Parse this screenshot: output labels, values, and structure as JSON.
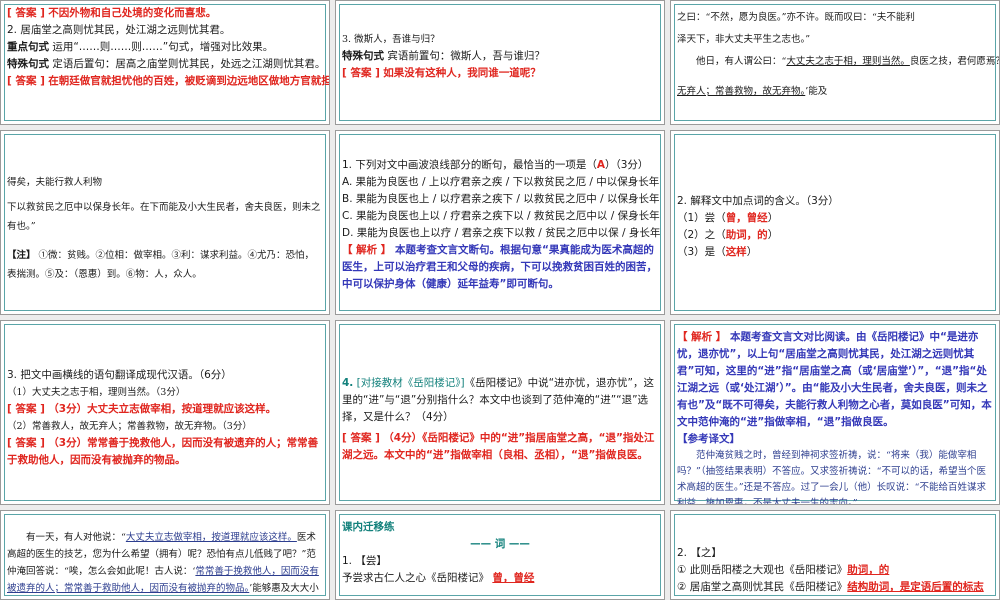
{
  "s1": {
    "l1_label": "[ 答案 ]",
    "l1_text": "不因外物和自己处境的变化而喜悲。",
    "l2": "2. 居庙堂之高则忧其民，处江湖之远则忧其君。",
    "l3_label": "重点句式",
    "l3_text": "运用“……则……则……”句式，增强对比效果。",
    "l4_label": "特殊句式",
    "l4_text": "定语后置句：居高之庙堂则忧其民，处远之江湖则忧其君。",
    "l5_label": "[ 答案 ]",
    "l5_text": "在朝廷做官就担忧他的百姓，被贬谪到边远地区做地方官就担忧他的君主。"
  },
  "s2": {
    "l1": "3. 微斯人，吾谁与归？",
    "l2_label": "特殊句式",
    "l2_text": "宾语前置句：微斯人，吾与谁归？",
    "l3_label": "[ 答案 ]",
    "l3_text": "如果没有这种人，我同谁一道呢？"
  },
  "s3": {
    "l1": "之曰：“不然，愿为良医。”亦不许。既而叹曰：“夫不能利",
    "l2": "泽天下，非大丈夫平生之志也。”",
    "l3_pre": "他日，有人谓公曰：“",
    "l3_ul": "大丈夫之志于相，理则当然。",
    "l3_post": "良医之技，君何愿焉？尤乃",
    "l4": "焉？尤乃",
    "l5_ul": "无弃人；常善救物，故无弃物。",
    "l5_post": "’能及"
  },
  "s4": {
    "l1": "得矣，夫能行救人利物",
    "l2": "下以救贫民之厄中以保身长年。在下而能及小大生民者，舍夫良医，则未之",
    "l3": "有也。”",
    "note_label": "【注】",
    "note_text": "①微：贫贱。②位相：做宰相。③利：谋求利益。④尤乃：恐怕，表揣测。⑤及：（恩惠）到。⑥物：人，众人。"
  },
  "s5": {
    "q_pre": "1. 下列对文中画波浪线部分的断句，最恰当的一项是（",
    "q_ans": "A",
    "q_post": "）（3分）",
    "a": "A. 果能为良医也 / 上以疗君亲之疾 / 下以救贫民之厄 / 中以保身长年",
    "b": "B. 果能为良医也上 / 以疗君亲之疾下 / 以救贫民之厄中 / 以保身长年",
    "c": "C. 果能为良医也上以 / 疗君亲之疾下以 / 救贫民之厄中以 / 保身长年",
    "d": "D. 果能为良医也上以疗 / 君亲之疾下以救 / 贫民之厄中以保 / 身长年",
    "exp_label": "【 解析 】",
    "exp_text": "本题考查文言文断句。根据句意“果真能成为医术高超的医生，上可以治疗君王和父母的疾病，下可以挽救贫困百姓的困苦，中可以保护身体（健康）延年益寿”即可断句。"
  },
  "s6": {
    "q": "2. 解释文中加点词的含义。（3分）",
    "i1_pre": "（1）尝",
    "i1_ans": "曾，曾经",
    "i1_post": "）",
    "i2_pre": "（2）之",
    "i2_ans": "助词，的",
    "i2_post": "）",
    "i3_pre": "（3）是",
    "i3_ans": "这样",
    "i3_post": "）"
  },
  "s7": {
    "q": "3. 把文中画横线的语句翻译成现代汉语。（6分）",
    "i1": "（1）大丈夫之志于相，理则当然。（3分）",
    "a1_label": "[ 答案 ]",
    "a1_text": "（3分）大丈夫立志做宰相，按道理就应该这样。",
    "i2": "（2）常善救人，故无弃人；常善救物，故无弃物。（3分）",
    "a2_label": "[ 答案 ]",
    "a2_text": "（3分）常常善于挽救他人，因而没有被遗弃的人；常常善于救助他人，因而没有被抛弃的物品。"
  },
  "s8": {
    "q_num": "4.",
    "q_tag": "[对接教材《岳阳楼记》]",
    "q_text": "《岳阳楼记》中说“进亦忧，退亦忧”，这里的“进”与“退”分别指什么？本文中也谈到了范仲淹的“进”“退”选择，又是什么？（4分）",
    "a_label": "[ 答案 ]",
    "a_text": "（4分）《岳阳楼记》中的“进”指居庙堂之高，“退”指处江湖之远。本文中的“进”指做宰相（良相、丞相），“退”指做良医。"
  },
  "s9": {
    "exp_label": "【 解析 】",
    "exp_text": "本题考查文言文对比阅读。由《岳阳楼记》中“是进亦忧，退亦忧”，以上句“居庙堂之高则忧其民，处江湖之远则忧其君”可知，这里的“进”指“居庙堂之高（或‘居庙堂’）”，“退”指“处江湖之远（或‘处江湖’）”。由“能及小大生民者，舍夫良医，则未之有也”及“既不可得矣，夫能行救人利物之心者，莫如良医”可知，本文中范仲淹的“进”指做宰相，“退”指做良医。",
    "ref_label": "【参考译文】",
    "ref_text": "范仲淹贫贱之时，曾经到神祠求签祈祷，说：“将来（我）能做宰相吗？”（抽签结果表明）不答应。又求签祈祷说：“不可以的话，希望当个医术高超的医生。”还是不答应。过了一会儿（他）长叹说：“不能给百姓谋求利益、施加恩惠，不是大丈夫一生的志向。”"
  },
  "s10": {
    "l1_pre": "有一天，有人对他说：“",
    "l1_ul": "大丈夫立志做宰相，按道理就应该这样。",
    "l1_post": "医术高超的医生的技艺，您为什么希望（拥有）呢？恐怕有点儿低贱了吧？”范仲淹回答说：“唉，怎么会如此呢！古人说：‘",
    "l2_ul": "常常善于挽救他人，因而没有被遗弃的人；常常善于救助他人，因而没有被抛弃的物品。",
    "l2_post": "’能够惠及大大小小的百姓"
  },
  "s11": {
    "title": "课内迁移练",
    "sub": "—— 词 ——",
    "l1": "1. 【尝】",
    "l2_pre": "予尝求古仁人之心《岳阳楼记》",
    "l2_ans": "曾，曾经"
  },
  "s12": {
    "l1": "2. 【之】",
    "l2_pre": "① 此则岳阳楼之大观也《岳阳楼记》",
    "l2_ans": "助词，的",
    "l3_pre": "② 居庙堂之高则忧其民《岳阳楼记》",
    "l3_ans": "结构助词，是定语后置的标志"
  }
}
